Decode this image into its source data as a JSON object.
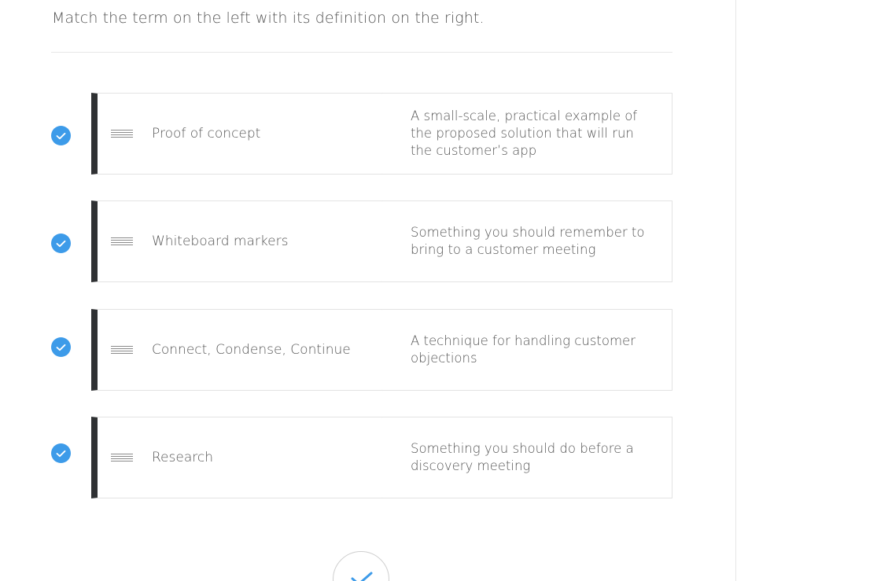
{
  "instructions": "Match the term on the left with its definition on the right.",
  "pairs": [
    {
      "term": "Proof of concept",
      "definition": "A small-scale, practical example of the proposed solution that will run the customer’s app",
      "status": "correct"
    },
    {
      "term": "Whiteboard markers",
      "definition": "Something you should remember to bring to a customer meeting",
      "status": "correct"
    },
    {
      "term": "Connect, Condense, Continue",
      "definition": "A technique for handling customer objections",
      "status": "correct"
    },
    {
      "term": "Research",
      "definition": "Something you should do before a discovery meeting",
      "status": "correct"
    }
  ],
  "colors": {
    "check": "#3d9be9",
    "term_bar": "#2f3133",
    "border": "#e3e3e3"
  },
  "icons": {
    "status": "check-circle-icon",
    "drag": "drag-handle-icon",
    "submit": "checkmark-icon"
  }
}
